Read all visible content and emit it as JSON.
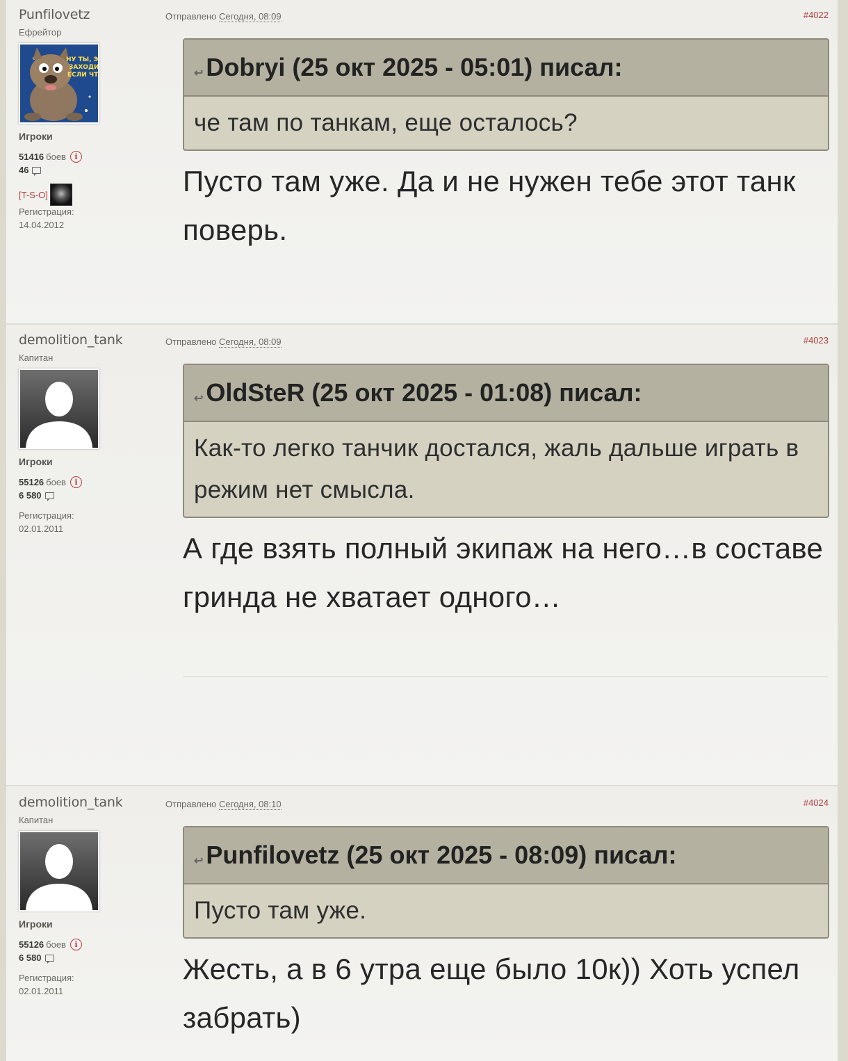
{
  "posts": [
    {
      "username": "Punfilovetz",
      "rank": "Ефрейтор",
      "group": "Игроки",
      "battles": "51416",
      "battles_label": "боев",
      "messages": "46",
      "clan": "[T-S-O]",
      "reg_label": "Регистрация:",
      "reg_date": "14.04.2012",
      "posted_label": "Отправлено",
      "posted_time": "Сегодня, 08:09",
      "post_number": "#4022",
      "quote_header": "Dobryi (25 окт 2025 - 05:01) писал:",
      "quote_text": "че там по танкам, еще осталось?",
      "text": "Пусто там уже. Да и не нужен тебе этот танк поверь."
    },
    {
      "username": "demolition_tank",
      "rank": "Капитан",
      "group": "Игроки",
      "battles": "55126",
      "battles_label": "боев",
      "messages": "6 580",
      "reg_label": "Регистрация:",
      "reg_date": "02.01.2011",
      "posted_label": "Отправлено",
      "posted_time": "Сегодня, 08:09",
      "post_number": "#4023",
      "quote_header": "OldSteR (25 окт 2025 - 01:08) писал:",
      "quote_text": "Как-то легко танчик достался, жаль дальше играть в режим нет смысла.",
      "text": "А где взять полный экипаж на него…в составе гринда не хватает одного…"
    },
    {
      "username": "demolition_tank",
      "rank": "Капитан",
      "group": "Игроки",
      "battles": "55126",
      "battles_label": "боев",
      "messages": "6 580",
      "reg_label": "Регистрация:",
      "reg_date": "02.01.2011",
      "posted_label": "Отправлено",
      "posted_time": "Сегодня, 08:10",
      "post_number": "#4024",
      "quote_header": "Punfilovetz (25 окт 2025 - 08:09) писал:",
      "quote_text": "Пусто там уже.",
      "text": "Жесть, а в 6 утра еще было 10к)) Хоть успел забрать)"
    }
  ],
  "icons": {
    "info": "info-icon",
    "messages": "speech-bubble-icon",
    "quote": "quote-arrow-icon"
  },
  "colors": {
    "link_red": "#b04040",
    "quote_head": "#b4b1a0",
    "quote_body": "#d5d2c2"
  }
}
